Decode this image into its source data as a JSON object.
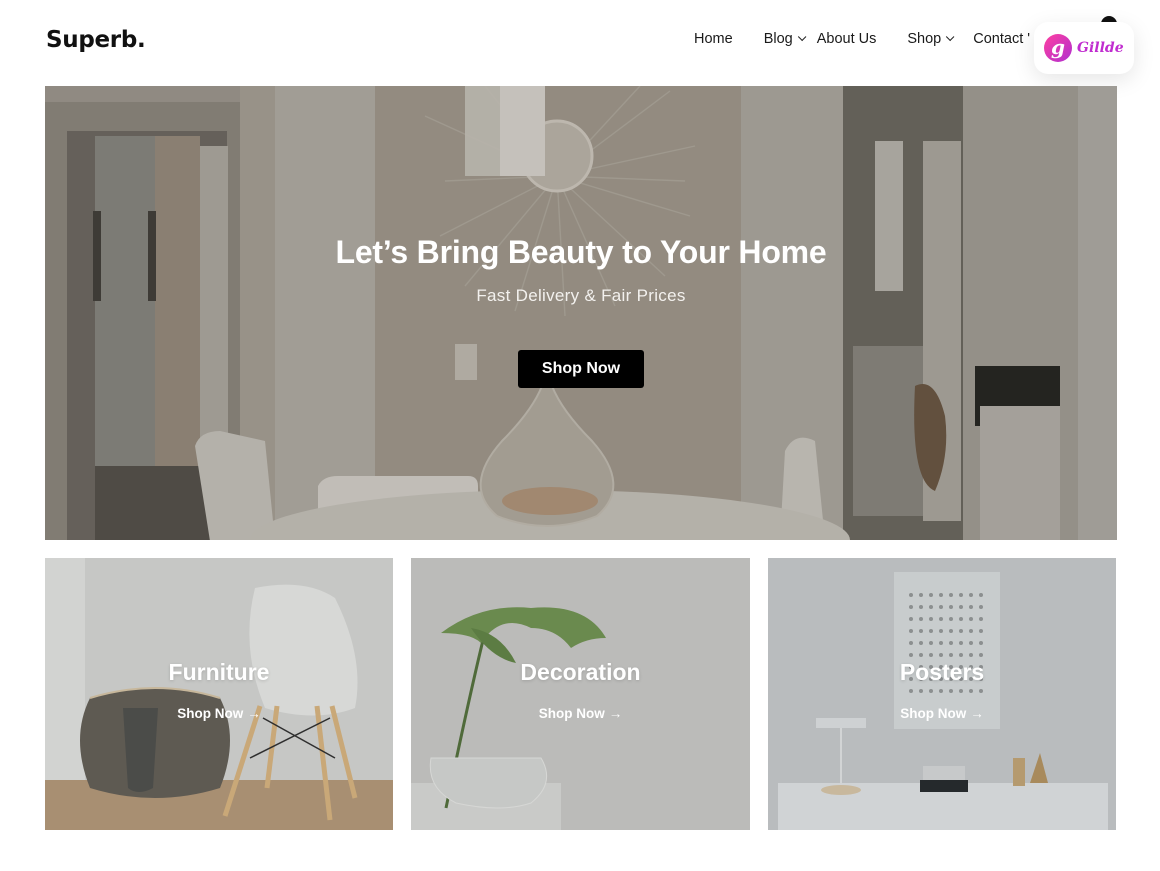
{
  "header": {
    "logo": "Superb.",
    "nav": [
      {
        "label": "Home",
        "has_dropdown": false
      },
      {
        "label": "Blog",
        "has_dropdown": true
      },
      {
        "label": "About Us",
        "has_dropdown": false
      },
      {
        "label": "Shop",
        "has_dropdown": true
      },
      {
        "label": "Contact '",
        "has_dropdown": false
      }
    ],
    "cart_icon": "cart-count-badge"
  },
  "overlay_widget": {
    "logo_letter": "g",
    "brand": "Gillde",
    "colors": {
      "gradient_start": "#ff3fa0",
      "gradient_end": "#b030d0",
      "text": "#c02ccf"
    }
  },
  "hero": {
    "title": "Let’s Bring Beauty to Your Home",
    "subtitle": "Fast Delivery & Fair Prices",
    "button_label": "Shop Now",
    "image": "dining-room-interior-photo"
  },
  "categories": [
    {
      "title": "Furniture",
      "link_label": "Shop Now",
      "arrow": "→",
      "image": "basket-and-chair-photo"
    },
    {
      "title": "Decoration",
      "link_label": "Shop Now",
      "arrow": "→",
      "image": "monstera-leaf-in-vase-photo"
    },
    {
      "title": "Posters",
      "link_label": "Shop Now",
      "arrow": "→",
      "image": "poster-on-wall-photo"
    }
  ],
  "colors": {
    "primary_button": "#000000",
    "text": "#111111",
    "background": "#ffffff"
  }
}
